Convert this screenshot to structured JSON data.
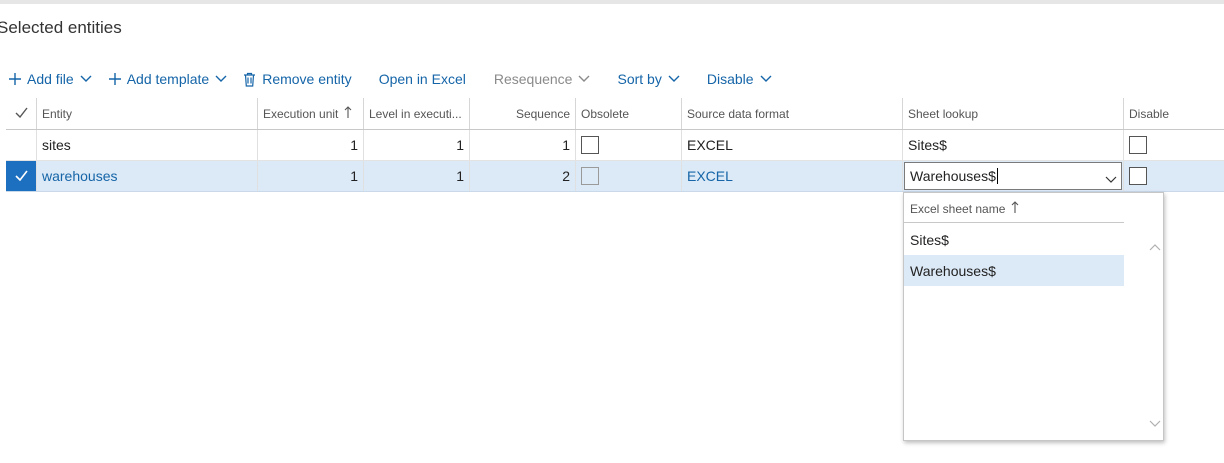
{
  "section_title": "Selected entities",
  "toolbar": {
    "add_file": "Add file",
    "add_template": "Add template",
    "remove_entity": "Remove entity",
    "open_in_excel": "Open in Excel",
    "resequence": "Resequence",
    "sort_by": "Sort by",
    "disable": "Disable"
  },
  "columns": {
    "entity": "Entity",
    "execution_unit": "Execution unit",
    "level": "Level in executi...",
    "sequence": "Sequence",
    "obsolete": "Obsolete",
    "source_format": "Source data format",
    "sheet_lookup": "Sheet lookup",
    "disable": "Disable"
  },
  "rows": [
    {
      "entity": "sites",
      "execution_unit": "1",
      "level": "1",
      "sequence": "1",
      "obsolete": false,
      "source_format": "EXCEL",
      "sheet_lookup": "Sites$",
      "disable": false,
      "selected": false
    },
    {
      "entity": "warehouses",
      "execution_unit": "1",
      "level": "1",
      "sequence": "2",
      "obsolete": false,
      "source_format": "EXCEL",
      "sheet_lookup": "Warehouses$",
      "disable": false,
      "selected": true
    }
  ],
  "lookup": {
    "header": "Excel sheet name",
    "items": [
      "Sites$",
      "Warehouses$"
    ],
    "selected_index": 1
  },
  "colors": {
    "accent": "#1565a8",
    "selected_row": "#dce9f6",
    "checkbox_selected": "#1d6fc0"
  },
  "icons": [
    "plus-icon",
    "chevron-down-icon",
    "trash-icon",
    "sort-ascending-icon",
    "check-icon",
    "scroll-up-icon",
    "scroll-down-icon"
  ]
}
